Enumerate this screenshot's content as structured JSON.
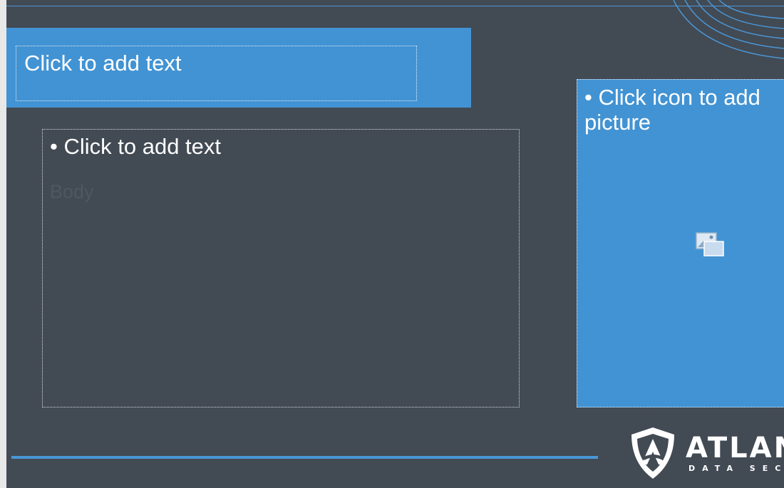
{
  "slide": {
    "title_placeholder": "Click to add text",
    "body_placeholder": "• Click to add text",
    "body_faint_text": "Body",
    "picture_placeholder": "• Click icon to add picture",
    "picture_icon": "insert-picture-icon"
  },
  "logo": {
    "wordmark": "ATLANTIC",
    "subtitle": "DATA SECURITY"
  },
  "colors": {
    "slide_background": "#424a54",
    "accent_blue": "#4293d3",
    "rule_blue": "#4a97d6",
    "app_background": "#e8e8e8"
  }
}
